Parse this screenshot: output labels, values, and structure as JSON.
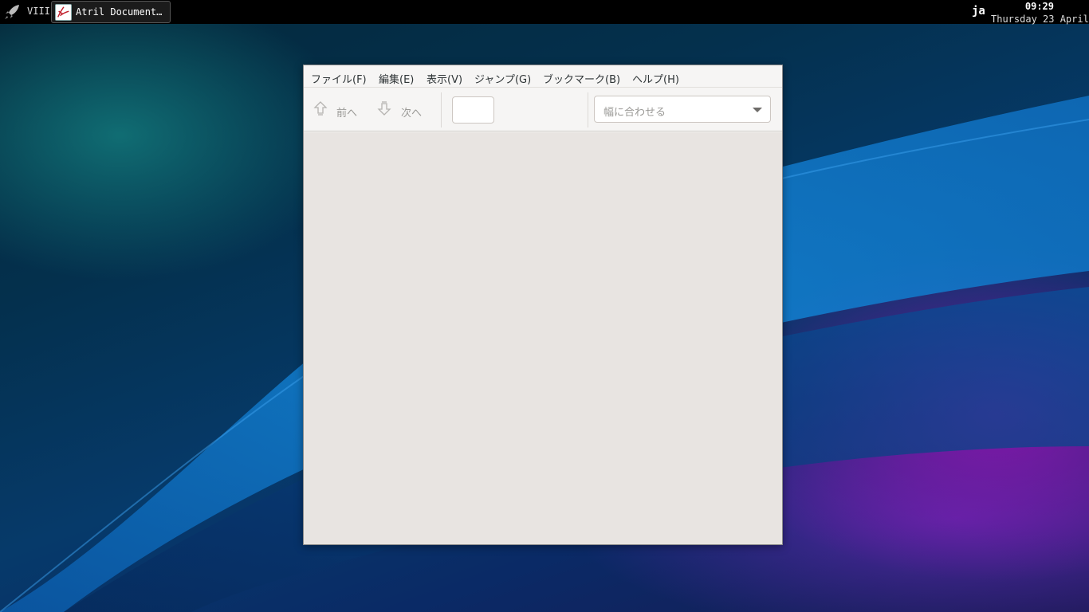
{
  "panel": {
    "workspace": "VIII",
    "task_title": "Atril Document…",
    "keyboard_layout": "ja",
    "time": "09:29",
    "date": "Thursday 23 April",
    "icons": [
      "rocket-icon",
      "atril-app-icon"
    ]
  },
  "window": {
    "menu": [
      "ファイル(F)",
      "編集(E)",
      "表示(V)",
      "ジャンプ(G)",
      "ブックマーク(B)",
      "ヘルプ(H)"
    ],
    "toolbar": {
      "prev_label": "前へ",
      "next_label": "次へ",
      "page_value": "",
      "zoom_value": "幅に合わせる"
    }
  },
  "colors": {
    "panel_bg": "#000000",
    "window_bg": "#f6f5f4",
    "viewer_bg": "#e8e4e1",
    "disabled_text": "#9a9996"
  }
}
